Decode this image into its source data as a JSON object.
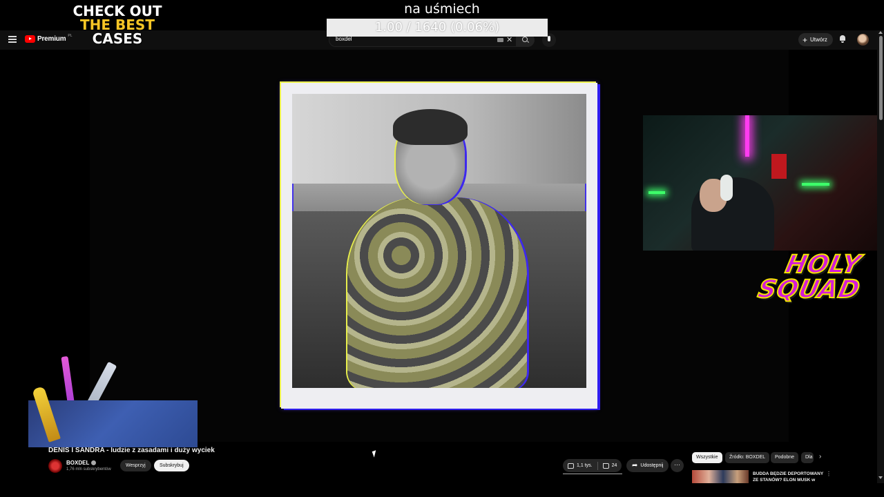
{
  "overlay": {
    "title": "na uśmiech",
    "counter": "1.00 / 1640 (0.06%)"
  },
  "topbar": {
    "logo_text": "Premium",
    "logo_region": "PL",
    "search_value": "boxdel",
    "create_label": "Utwórz"
  },
  "promo": {
    "line1": "CHECK OUT",
    "line2": "THE BEST",
    "line3": "CASES"
  },
  "overlay_logo": {
    "line1": "HOLY",
    "line2": "SQUAD"
  },
  "video": {
    "title": "DENIS I SANDRA - ludzie z zasadami i duży wyciek",
    "channel_name": "BOXDEL",
    "subscribers": "1,76 mln subskrybentów",
    "support_label": "Wesprzyj",
    "subscribe_label": "Subskrybuj",
    "likes": "1,1 tys.",
    "dislikes": "24",
    "share_label": "Udostępnij",
    "more_label": "···"
  },
  "chips": [
    "Wszystkie",
    "Źródło: BOXDEL",
    "Podobne",
    "Dla"
  ],
  "recommended": {
    "title": "BUDDA BĘDZIE DEPORTOWANY ZE STANÓW? ELON MUSK w"
  },
  "icons": [
    "menu-icon",
    "youtube-logo-icon",
    "keyboard-icon",
    "clear-icon",
    "search-icon",
    "mic-icon",
    "plus-icon",
    "bell-icon",
    "verified-icon",
    "thumb-up-icon",
    "thumb-down-icon",
    "share-icon",
    "chevron-right-icon"
  ],
  "colors": {
    "background": "#0f0f0f",
    "brand_red": "#ff0000",
    "frame_yellow": "#ecf14a",
    "frame_blue": "#2f1df0",
    "logo_magenta": "#d41bd8",
    "logo_yellow": "#f2e400"
  }
}
